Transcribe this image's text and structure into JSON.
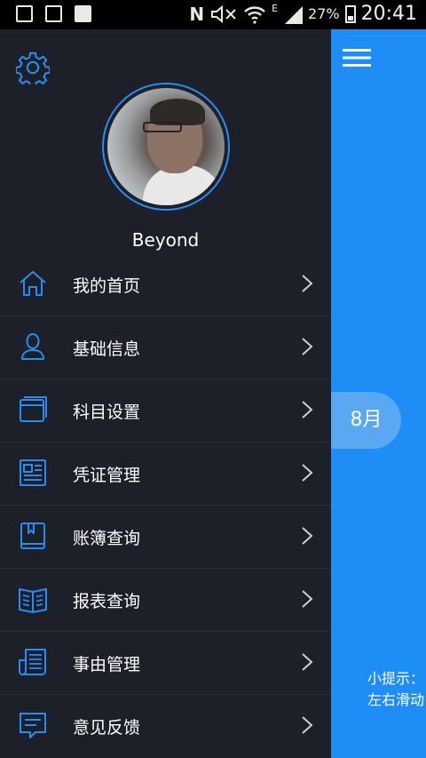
{
  "status_bar": {
    "time": "20:41",
    "battery": "27%",
    "network": "E",
    "carrier_badge": "N"
  },
  "drawer": {
    "username": "Beyond",
    "menu": [
      {
        "label": "我的首页",
        "icon": "home-icon"
      },
      {
        "label": "基础信息",
        "icon": "user-icon"
      },
      {
        "label": "科目设置",
        "icon": "window-icon"
      },
      {
        "label": "凭证管理",
        "icon": "document-icon"
      },
      {
        "label": "账簿查询",
        "icon": "book-icon"
      },
      {
        "label": "报表查询",
        "icon": "open-book-icon"
      },
      {
        "label": "事由管理",
        "icon": "newspaper-icon"
      },
      {
        "label": "意见反馈",
        "icon": "feedback-icon"
      }
    ]
  },
  "main": {
    "month": "8月",
    "tip_line1": "小提示：",
    "tip_line2": "左右滑动"
  },
  "colors": {
    "drawer_bg": "#1d1f29",
    "accent": "#1e8df5",
    "icon_blue": "#2a8cf2"
  }
}
